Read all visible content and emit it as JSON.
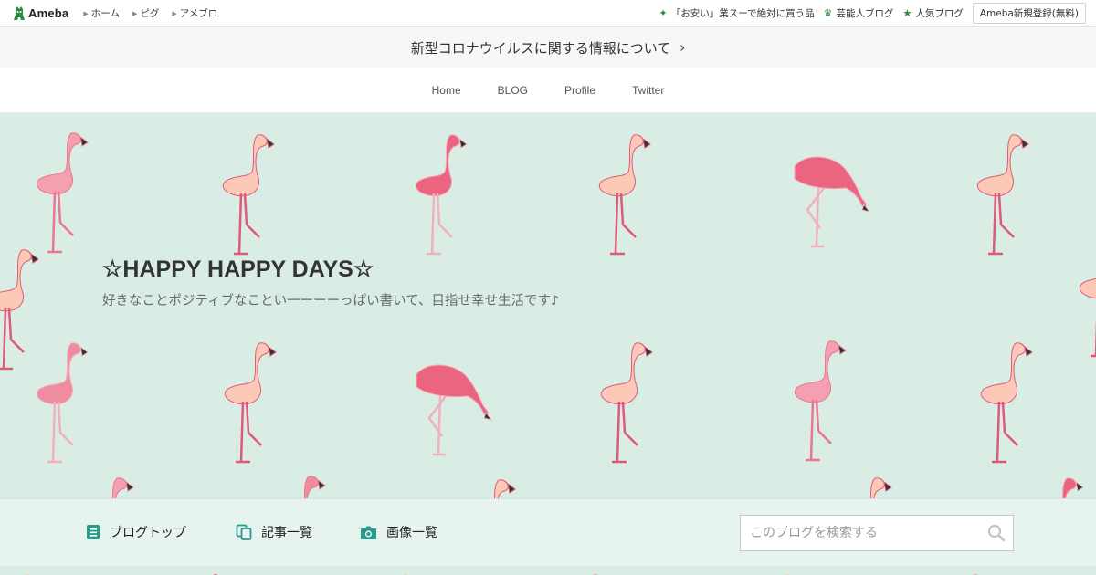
{
  "header": {
    "logo_text": "Ameba",
    "nav": [
      {
        "label": "ホーム"
      },
      {
        "label": "ピグ"
      },
      {
        "label": "アメブロ"
      }
    ],
    "right_links": [
      {
        "label": "「お安い」業スーで絶対に買う品",
        "icon": "sparkle-icon"
      },
      {
        "label": "芸能人ブログ",
        "icon": "crown-icon"
      },
      {
        "label": "人気ブログ",
        "icon": "star-icon"
      }
    ],
    "signup_label": "Ameba新規登録(無料)"
  },
  "notice": {
    "text": "新型コロナウイルスに関する情報について",
    "chevron": "›"
  },
  "blog_nav": {
    "items": [
      "Home",
      "BLOG",
      "Profile",
      "Twitter"
    ]
  },
  "hero": {
    "title": "☆HAPPY HAPPY DAYS☆",
    "description": "好きなことポジティブなことい一ーーーっぱい書いて、目指せ幸せ生活です♪",
    "background_color": "#d9ede4",
    "flamingo_colors": [
      "#f08ca0",
      "#fcc8b4",
      "#e8506e"
    ]
  },
  "menu": {
    "items": [
      {
        "label": "ブログトップ",
        "icon": "document-icon"
      },
      {
        "label": "記事一覧",
        "icon": "copy-icon"
      },
      {
        "label": "画像一覧",
        "icon": "camera-icon"
      }
    ],
    "search_placeholder": "このブログを検索する",
    "accent": "#2a9a8e"
  }
}
